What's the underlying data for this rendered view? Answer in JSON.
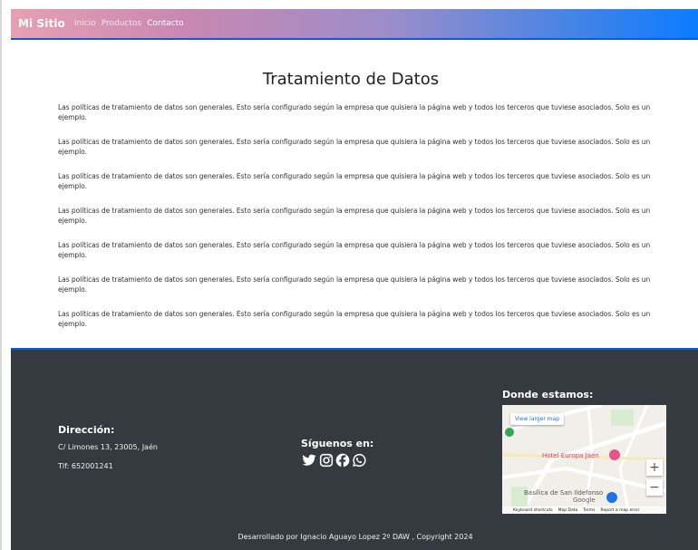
{
  "navbar": {
    "brand": "Mi Sitio",
    "links": [
      "Inicio",
      "Productos",
      "Contacto"
    ],
    "active_index": 2
  },
  "main": {
    "title": "Tratamiento de Datos",
    "paragraphs": [
      "Las políticas de tratamiento de datos son generales. Esto sería configurado según la empresa que quisiera la página web y todos los terceros que tuviese asociados. Solo es un ejemplo.",
      "Las políticas de tratamiento de datos son generales. Esto sería configurado según la empresa que quisiera la página web y todos los terceros que tuviese asociados. Solo es un ejemplo.",
      "Las políticas de tratamiento de datos son generales. Esto sería configurado según la empresa que quisiera la página web y todos los terceros que tuviese asociados. Solo es un ejemplo.",
      "Las políticas de tratamiento de datos son generales. Esto sería configurado según la empresa que quisiera la página web y todos los terceros que tuviese asociados. Solo es un ejemplo.",
      "Las políticas de tratamiento de datos son generales. Esto sería configurado según la empresa que quisiera la página web y todos los terceros que tuviese asociados. Solo es un ejemplo.",
      "Las políticas de tratamiento de datos son generales. Esto sería configurado según la empresa que quisiera la página web y todos los terceros que tuviese asociados. Solo es un ejemplo.",
      "Las políticas de tratamiento de datos son generales. Esto sería configurado según la empresa que quisiera la página web y todos los terceros que tuviese asociados. Solo es un ejemplo."
    ]
  },
  "footer": {
    "address_heading": "Dirección:",
    "address": "C/ Limones 13, 23005, Jaén",
    "phone": "Tlf: 652001241",
    "social_heading": "Síguenos en:",
    "social_icons": [
      "twitter-icon",
      "instagram-icon",
      "facebook-icon",
      "whatsapp-icon"
    ],
    "map_heading": "Donde estamos:",
    "map": {
      "view_larger": "View larger map",
      "hotel_label": "Hotel Europa Jaén",
      "basilica_label": "Basílica de San Ildefonso",
      "google_label": "Google",
      "zoom_in": "+",
      "zoom_out": "−",
      "attribution": [
        "Keyboard shortcuts",
        "Map Data",
        "Terms",
        "Report a map error"
      ]
    },
    "copyright": "Desarrollado por Ignacio Aguayo Lopez 2º DAW , Copyright 2024"
  },
  "colors": {
    "nav_gradient_start": "#e7a0b3",
    "nav_gradient_end": "#0b7cff",
    "footer_bg": "#343a40",
    "accent_border": "#0b5bd7"
  }
}
